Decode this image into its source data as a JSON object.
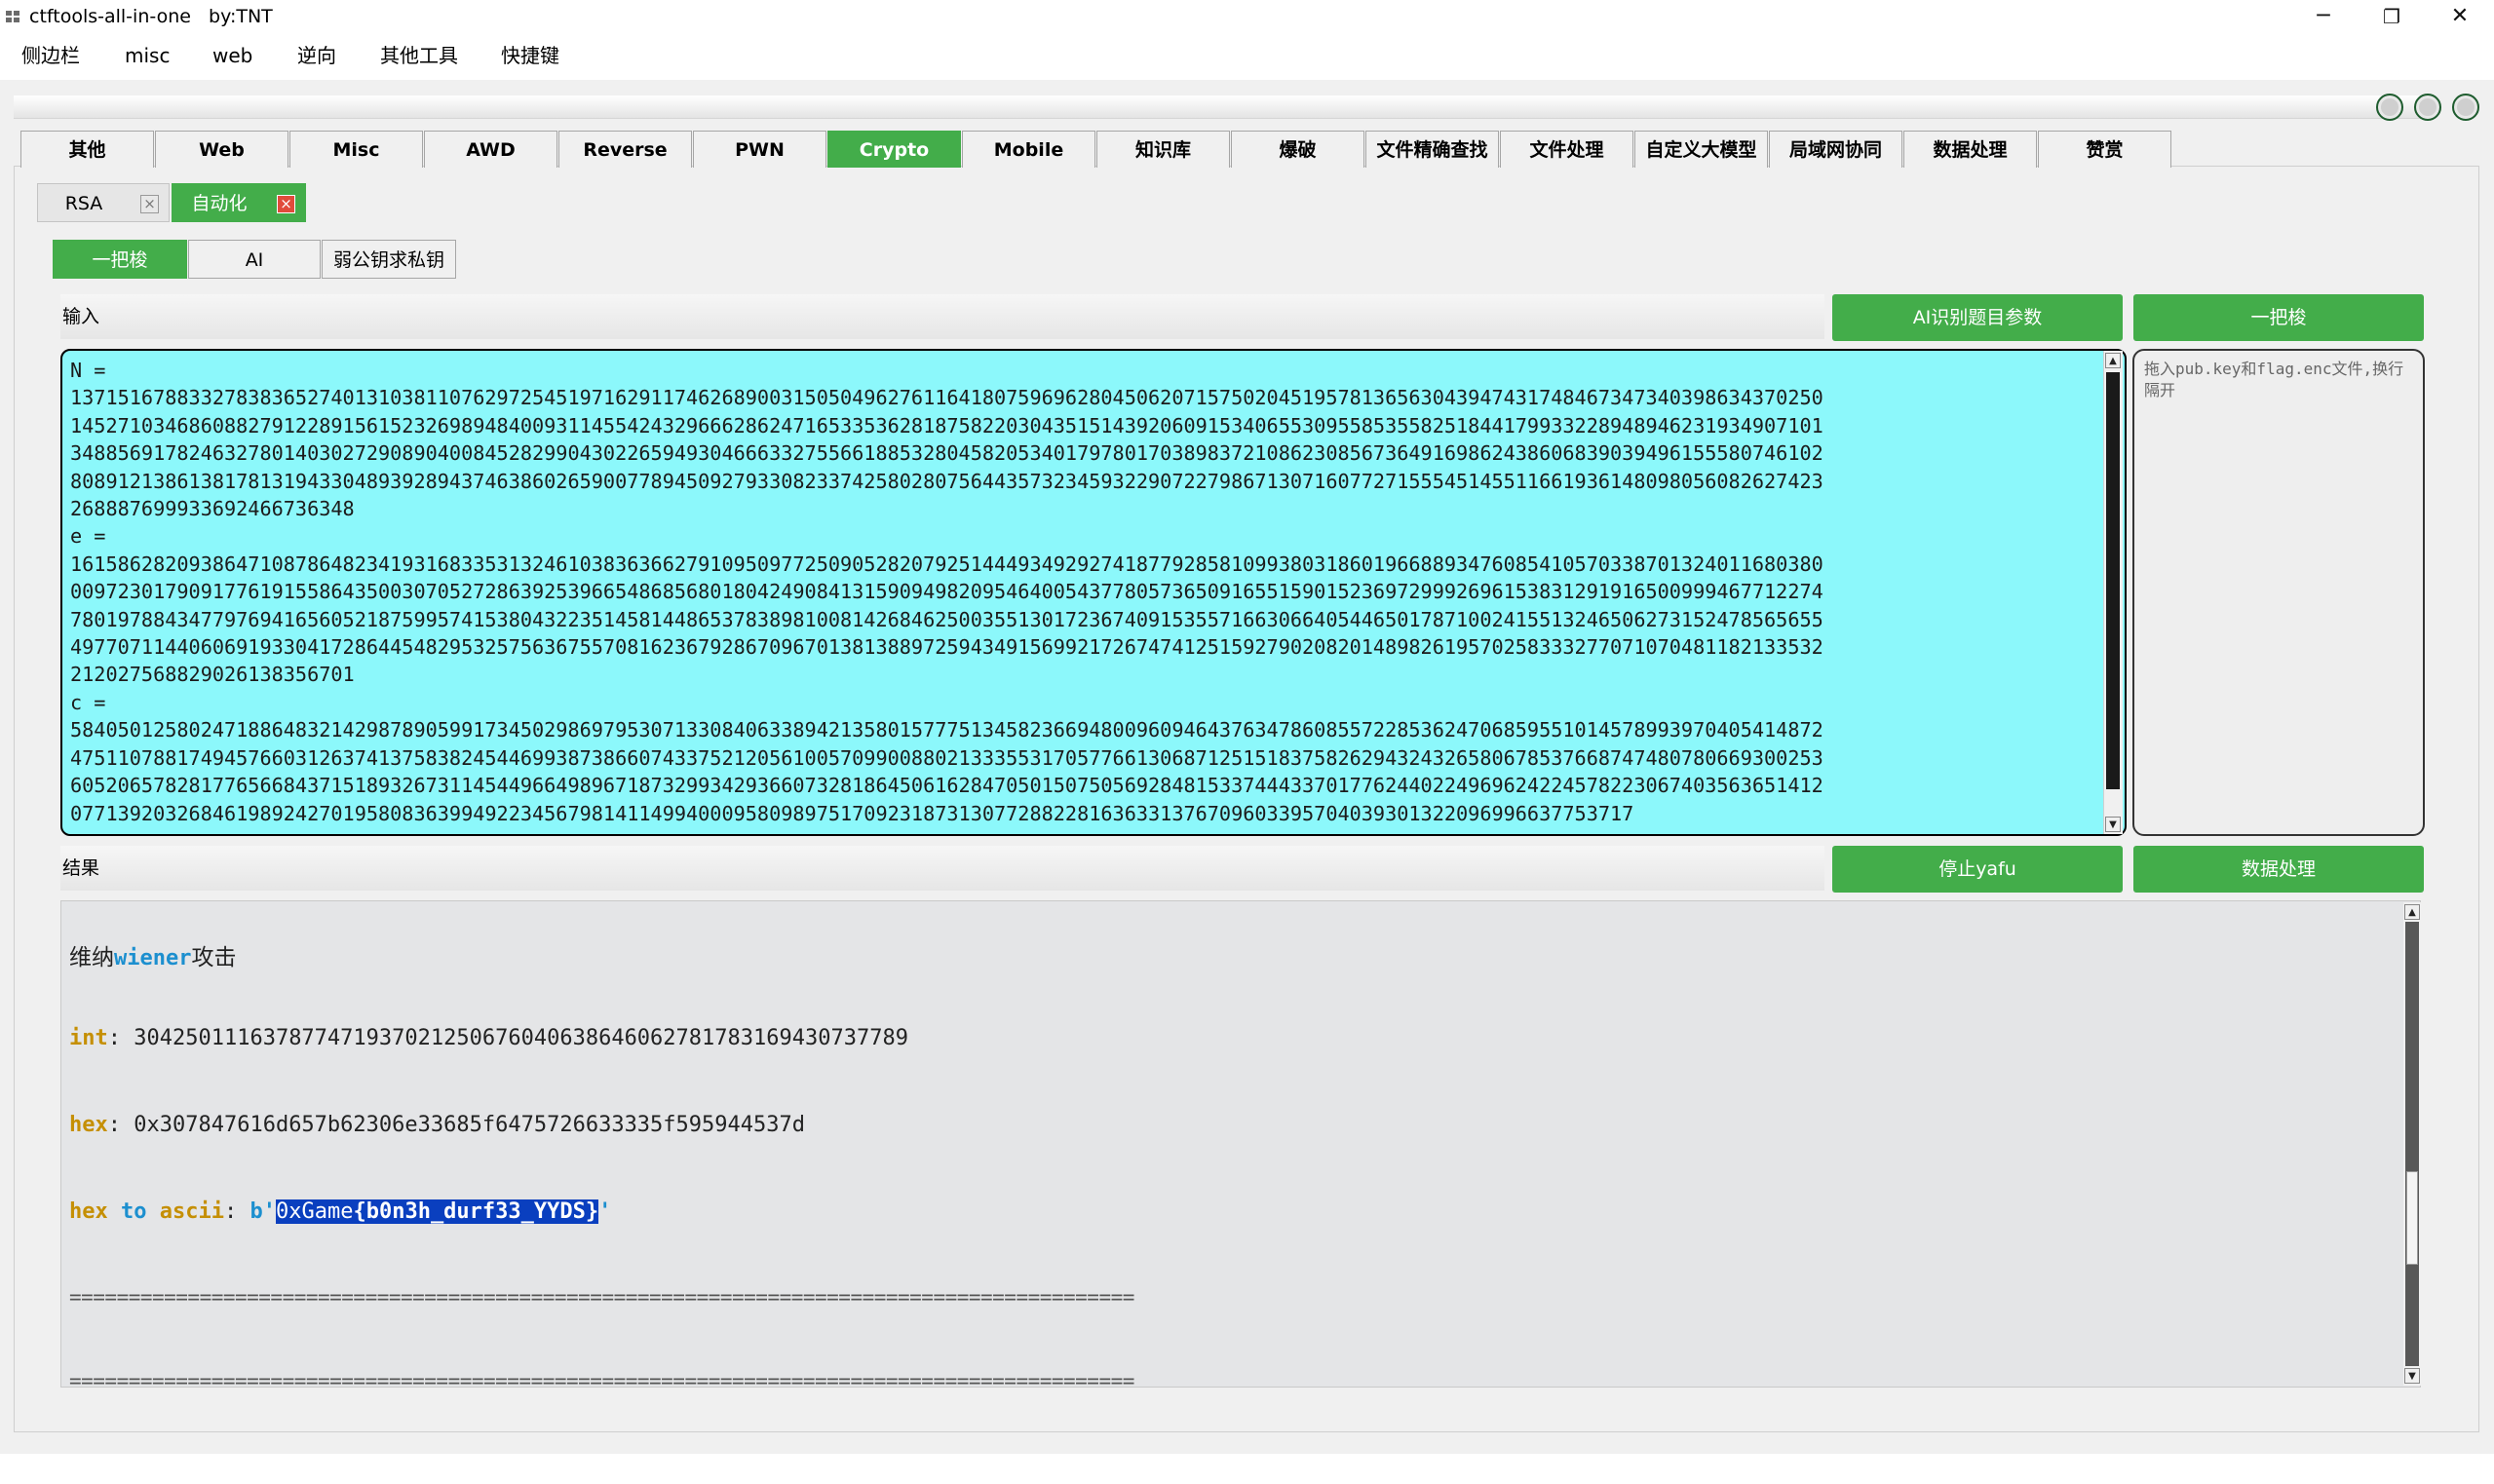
{
  "window": {
    "title": "ctftools-all-in-one   by:TNT",
    "minimize": "─",
    "maximize": "❐",
    "close": "✕"
  },
  "menu": [
    "侧边栏",
    "misc",
    "web",
    "逆向",
    "其他工具",
    "快捷键"
  ],
  "top_tabs": [
    "其他",
    "Web",
    "Misc",
    "AWD",
    "Reverse",
    "PWN",
    "Crypto",
    "Mobile",
    "知识库",
    "爆破",
    "文件精确查找",
    "文件处理",
    "自定义大模型",
    "局域网协同",
    "数据处理",
    "赞赏"
  ],
  "active_top_tab": "Crypto",
  "sub_tabs": [
    {
      "label": "RSA",
      "close": "×"
    },
    {
      "label": "自动化",
      "close": "×"
    }
  ],
  "tool_tabs": [
    "一把梭",
    "AI",
    "弱公钥求私钥"
  ],
  "input_section": {
    "label": "输入",
    "ai_button": "AI识别题目参数",
    "run_button": "一把梭",
    "text": "N =\n1371516788332783836527401310381107629725451971629117462689003150504962761164180759696280450620715750204519578136563043947431748467347340398634370250145271034686088279122891561523269894840093114554243296662862471653353628187582203043515143920609153406553095585355825184417993322894894623193490710134885691782463278014030272908904008452829904302265949304666332755661885328045820534017978017038983721086230856736491698624386068390394961555807461028089121386138178131943304893928943746386026590077894509279330823374258028075644357323459322907227986713071607727155545145511661936148098056082627423268887699933692466736348\ne =\n1615862820938647108786482341931683353132461038363662791095097725090528207925144493492927418779285810993803186019668893476085410570338701324011680380009723017909177619155864350030705272863925396654868568018042490841315909498209546400543778057365091655159015236972999269615383129191650099946771227478019788434779769416560521875995741538043223514581448653783898100814268462500355130172367409153557166306640544650178710024155132465062731524785656554977071144060691933041728644548295325756367557081623679286709670138138897259434915699217267474125159279020820148982619570258333277071070481182133532212027568829026138356701\nc =\n584050125802471886483214298789059917345029869795307133084063389421358015777513458236694800960946437634786085572285362470685955101457899397040541487247511078817494576603126374137583824544699387386607433752120561005709900880213335531705776613068712515183758262943243265806785376687474807806693002536052065782817765668437151893267311454496649896718732993429366073281864506162847050150750569284815337444337017762440224969624224578223067403563651412077139203268461989242701958083639949223456798141149940009580989751709231873130772882281636331376709603395704039301322096996637753717"
  },
  "drop_box": {
    "placeholder": "拖入pub.key和flag.enc文件,换行隔开"
  },
  "result_section": {
    "label": "结果",
    "stop_button": "停止yafu",
    "data_button": "数据处理",
    "heading_prefix": "维纳",
    "heading_keyword": "wiener",
    "heading_suffix": "攻击",
    "int_key": "int",
    "int_value": "30425011163787747193702125067604063864606278178316943073778​9",
    "hex_key": "hex",
    "hex_value": "0x307847616d657b62306e33685f6475726633335f595944537d",
    "ascii_key_a": "hex",
    "ascii_key_b": "to",
    "ascii_key_c": "ascii",
    "ascii_prefix": "b'",
    "ascii_sel_plain": "0xGame",
    "ascii_sel_bold": "{b0n3h_durf33_YYDS}",
    "ascii_suffix": "'",
    "separator": "=========================================================================================="
  },
  "colors": {
    "accent": "#43ad4a",
    "input_bg": "#8cf8fb",
    "close_red": "#e14b3b",
    "selection": "#0a3fbf"
  }
}
